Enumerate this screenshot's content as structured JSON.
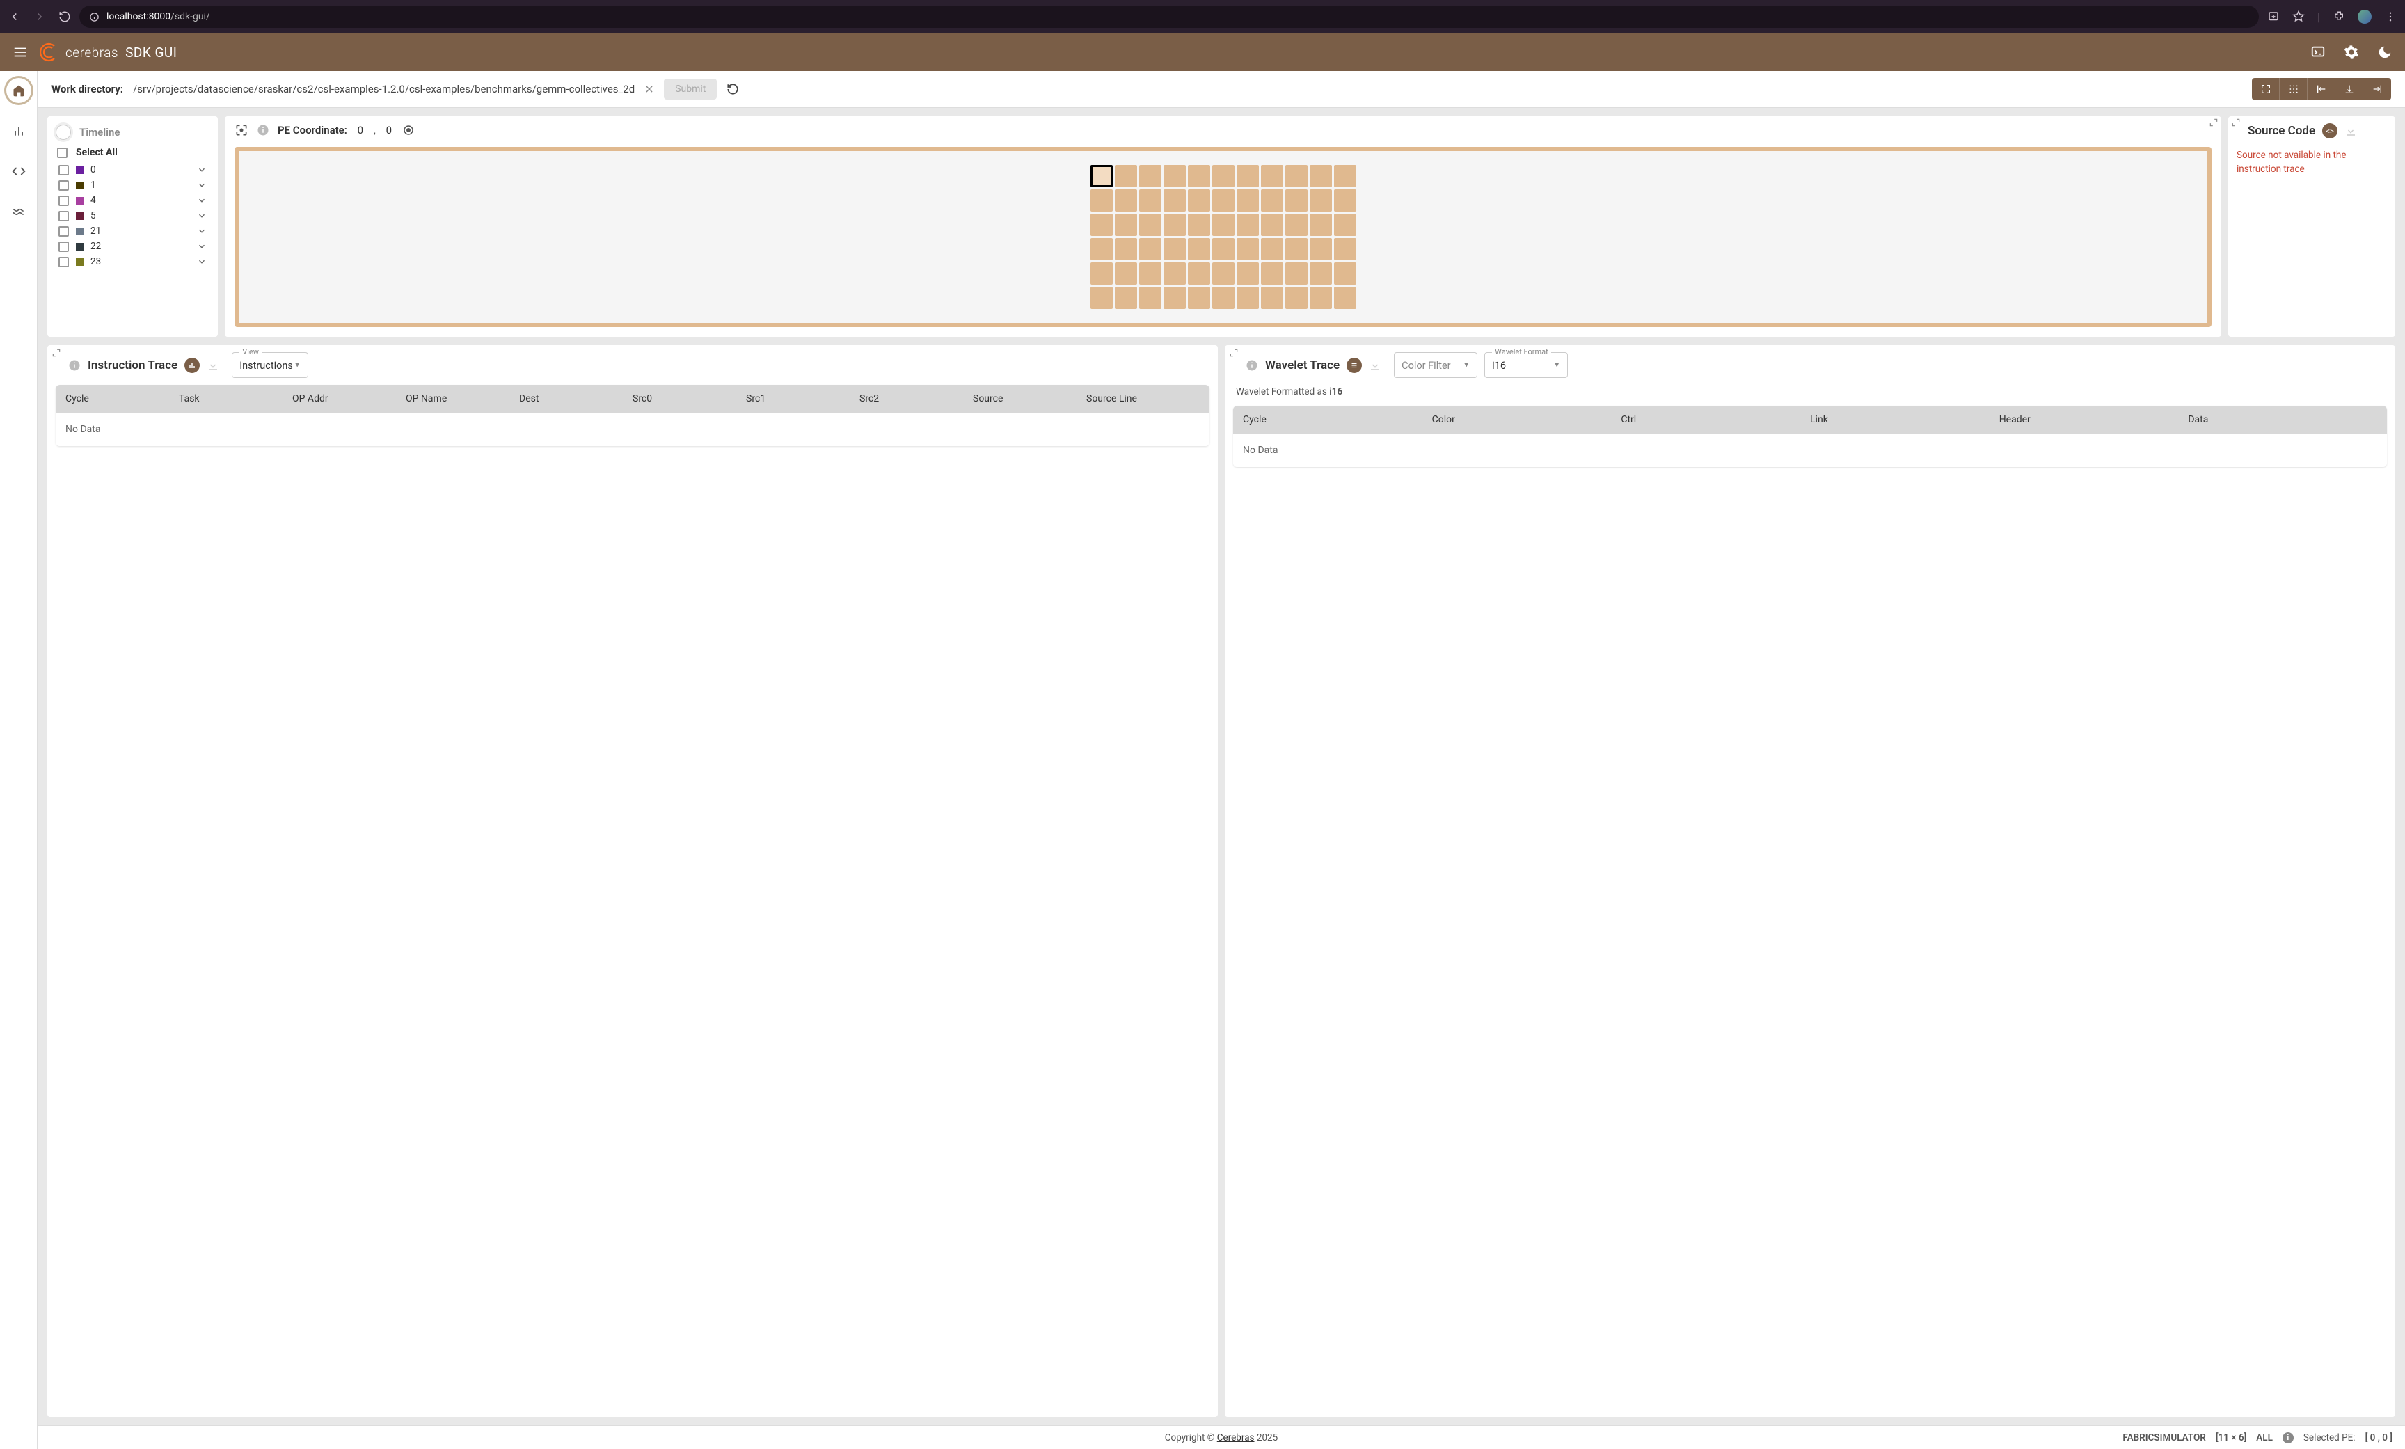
{
  "browser": {
    "url_host": "localhost:8000",
    "url_path": "/sdk-gui/"
  },
  "app": {
    "brand": "cerebras",
    "title": "SDK GUI"
  },
  "workdir": {
    "label": "Work directory:",
    "path": "/srv/projects/datascience/sraskar/cs2/csl-examples-1.2.0/csl-examples/benchmarks/gemm-collectives_2d",
    "submit": "Submit"
  },
  "timeline": {
    "title": "Timeline",
    "select_all": "Select All",
    "items": [
      {
        "label": "0",
        "color": "#6b1fa0"
      },
      {
        "label": "1",
        "color": "#4a3b00"
      },
      {
        "label": "4",
        "color": "#a83fa0"
      },
      {
        "label": "5",
        "color": "#6b1f3a"
      },
      {
        "label": "21",
        "color": "#6c7a8a"
      },
      {
        "label": "22",
        "color": "#2f3a3f"
      },
      {
        "label": "23",
        "color": "#7a7a1f"
      }
    ]
  },
  "pe": {
    "coord_label": "PE Coordinate:",
    "x": "0",
    "comma": ",",
    "y": "0",
    "cols": 11,
    "rows": 6,
    "selected_row": 0,
    "selected_col": 0
  },
  "source": {
    "title": "Source Code",
    "msg": "Source not available in the instruction trace"
  },
  "instr": {
    "title": "Instruction Trace",
    "view_label": "View",
    "view_value": "Instructions",
    "columns": [
      "Cycle",
      "Task",
      "OP Addr",
      "OP Name",
      "Dest",
      "Src0",
      "Src1",
      "Src2",
      "Source",
      "Source Line"
    ],
    "no_data": "No Data"
  },
  "wavelet": {
    "title": "Wavelet Trace",
    "filter_value": "Color Filter",
    "format_label": "Wavelet Format",
    "format_value": "i16",
    "note_prefix": "Wavelet Formatted as ",
    "note_value": "i16",
    "columns": [
      "Cycle",
      "Color",
      "Ctrl",
      "Link",
      "Header",
      "Data"
    ],
    "no_data": "No Data"
  },
  "footer": {
    "copyright_pre": "Copyright © ",
    "copyright_link": "Cerebras",
    "copyright_post": " 2025",
    "sim": "FABRICSIMULATOR",
    "dim": "[11 × 6]",
    "all": "ALL",
    "selected_pe_label": "Selected PE:",
    "selected_pe_value": "[ 0 , 0 ]"
  }
}
